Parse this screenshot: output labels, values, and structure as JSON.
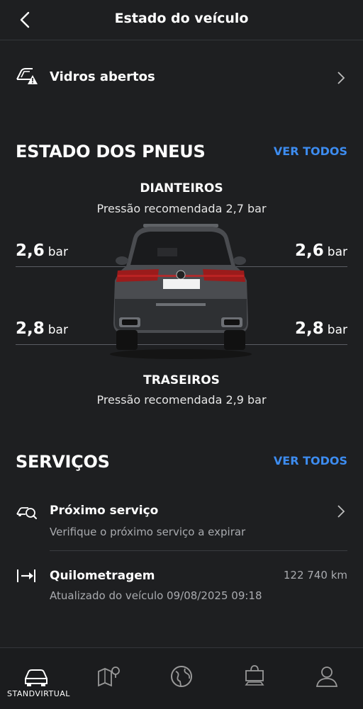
{
  "header": {
    "title": "Estado do veículo",
    "back_icon": "chevron-left-icon"
  },
  "windows_row": {
    "label": "Vidros abertos",
    "icon": "car-window-warning-icon"
  },
  "tyres": {
    "section_title": "ESTADO DOS PNEUS",
    "see_all": "VER TODOS",
    "front_heading": "DIANTEIROS",
    "front_recommended": "Pressão recomendada 2,7 bar",
    "rear_heading": "TRASEIROS",
    "rear_recommended": "Pressão recomendada 2,9 bar",
    "unit": "bar",
    "front_left": "2,6",
    "front_right": "2,6",
    "rear_left": "2,8",
    "rear_right": "2,8"
  },
  "services": {
    "section_title": "SERVIÇOS",
    "see_all": "VER TODOS",
    "next_service": {
      "title": "Próximo serviço",
      "desc": "Verifique o próximo serviço a expirar",
      "icon": "service-car-icon"
    },
    "mileage": {
      "title": "Quilometragem",
      "value": "122 740 km",
      "desc": "Atualizado do veículo 09/08/2025 09:18",
      "icon": "odometer-arrow-icon"
    }
  },
  "bottom_nav": {
    "items": [
      "car-icon",
      "map-pin-icon",
      "globe-icon",
      "shop-bag-icon",
      "profile-icon"
    ],
    "watermark": "STANDVIRTUAL"
  },
  "colors": {
    "background": "#1e1f21",
    "accent": "#3d8cf0"
  }
}
